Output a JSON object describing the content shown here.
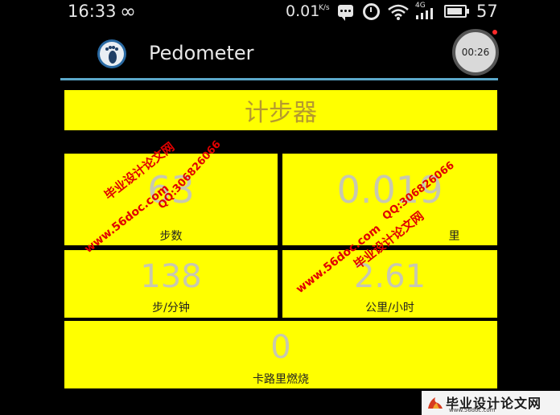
{
  "status_bar": {
    "time": "16:33",
    "net_speed": "0.01",
    "net_unit": "K/s",
    "network_type": "4G",
    "battery_level": "57"
  },
  "app": {
    "title": "Pedometer",
    "record_timer": "00:26"
  },
  "main": {
    "title": "计步器",
    "steps": {
      "value": "63",
      "label": "步数"
    },
    "distance": {
      "value": "0.019",
      "label": "里"
    },
    "pace": {
      "value": "138",
      "label": "步/分钟"
    },
    "speed": {
      "value": "2.61",
      "label": "公里/小时"
    },
    "calories": {
      "value": "0",
      "label": "卡路里燃烧"
    }
  },
  "watermarks": {
    "site_cn": "毕业设计论文网",
    "site_url": "www.56doc.com",
    "qq": "QQ:306826066",
    "footer_cn": "毕业设计论文网",
    "footer_url": "www.56doc.com"
  },
  "colors": {
    "panel": "#ffff00",
    "accent_line": "#5aa7c9",
    "watermark": "#e10000"
  }
}
